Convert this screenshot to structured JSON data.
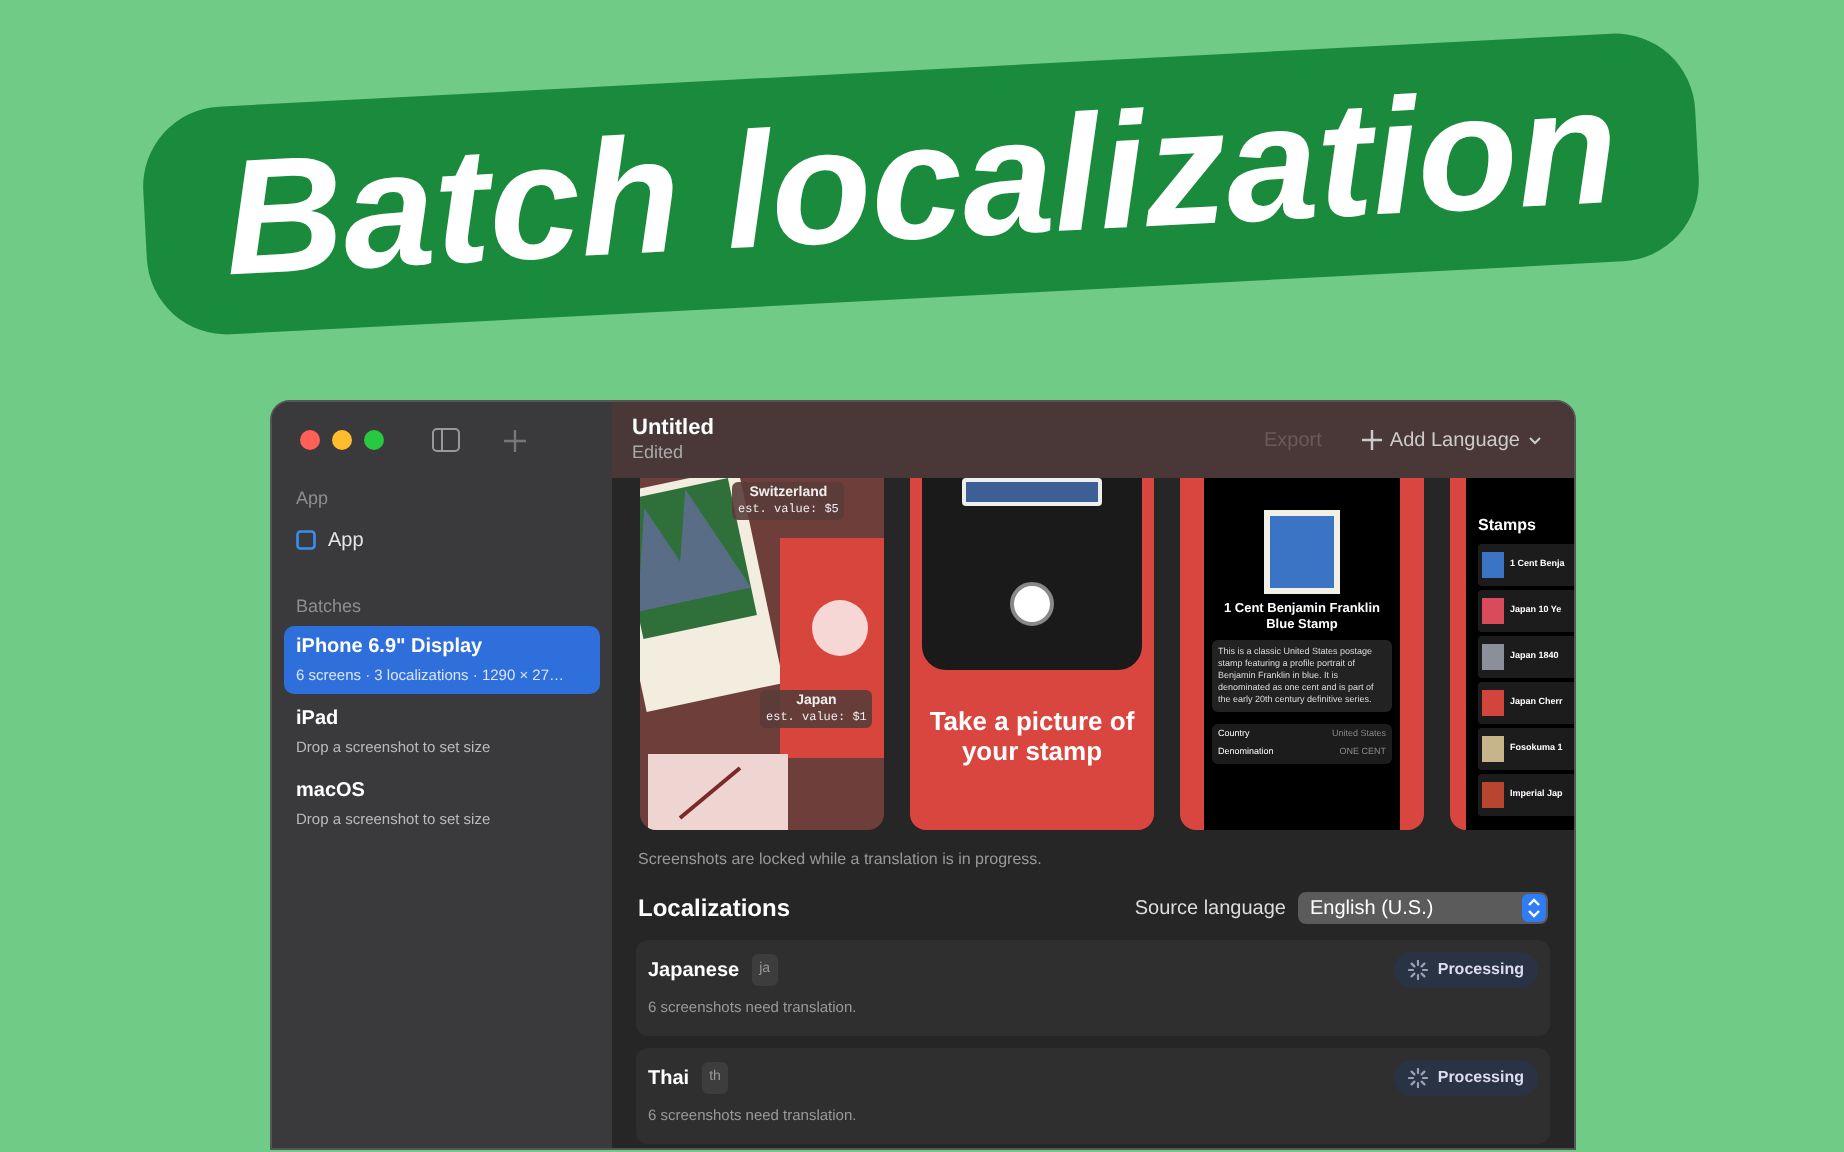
{
  "banner": {
    "title": "Batch localization"
  },
  "window": {
    "title": "Untitled",
    "subtitle": "Edited"
  },
  "toolbar": {
    "export": {
      "label": "Export",
      "disabled": true
    },
    "add_language": "Add Language"
  },
  "sidebar": {
    "sections": [
      {
        "label": "App",
        "items": [
          {
            "kind": "app",
            "title": "App",
            "selected": false
          }
        ]
      },
      {
        "label": "Batches",
        "items": [
          {
            "kind": "batch",
            "title": "iPhone 6.9\" Display",
            "subtitle": "6 screens · 3 localizations · 1290 × 27…",
            "selected": true
          },
          {
            "kind": "batch",
            "title": "iPad",
            "subtitle": "Drop a screenshot to set size",
            "selected": false
          },
          {
            "kind": "batch",
            "title": "macOS",
            "subtitle": "Drop a screenshot to set size",
            "selected": false
          }
        ]
      }
    ]
  },
  "screenshots": [
    {
      "kind": "collage",
      "labels": [
        {
          "title": "Switzerland",
          "value": "est. value: $5"
        },
        {
          "title": "Japan",
          "value": "est. value: $1"
        }
      ]
    },
    {
      "kind": "capture",
      "headline": "Take a picture of your stamp"
    },
    {
      "kind": "detail",
      "title": "1 Cent Benjamin Franklin Blue Stamp",
      "description": "This is a classic United States postage stamp featuring a profile portrait of Benjamin Franklin in blue. It is denominated as one cent and is part of the early 20th century definitive series.",
      "fields": [
        {
          "label": "Country",
          "value": "United States"
        },
        {
          "label": "Denomination",
          "value": "ONE CENT"
        }
      ]
    },
    {
      "kind": "list",
      "heading": "Stamps",
      "items": [
        "1 Cent Benja",
        "Japan 10 Ye",
        "Japan 1840",
        "Japan Cherr",
        "Fosokuma 1",
        "Imperial Jap"
      ]
    }
  ],
  "lock_note": "Screenshots are locked while a translation is in progress.",
  "localizations": {
    "heading": "Localizations",
    "source_label": "Source language",
    "source_value": "English (U.S.)",
    "items": [
      {
        "language": "Japanese",
        "code": "ja",
        "status": "Processing",
        "note": "6 screenshots need translation."
      },
      {
        "language": "Thai",
        "code": "th",
        "status": "Processing",
        "note": "6 screenshots need translation."
      }
    ]
  }
}
